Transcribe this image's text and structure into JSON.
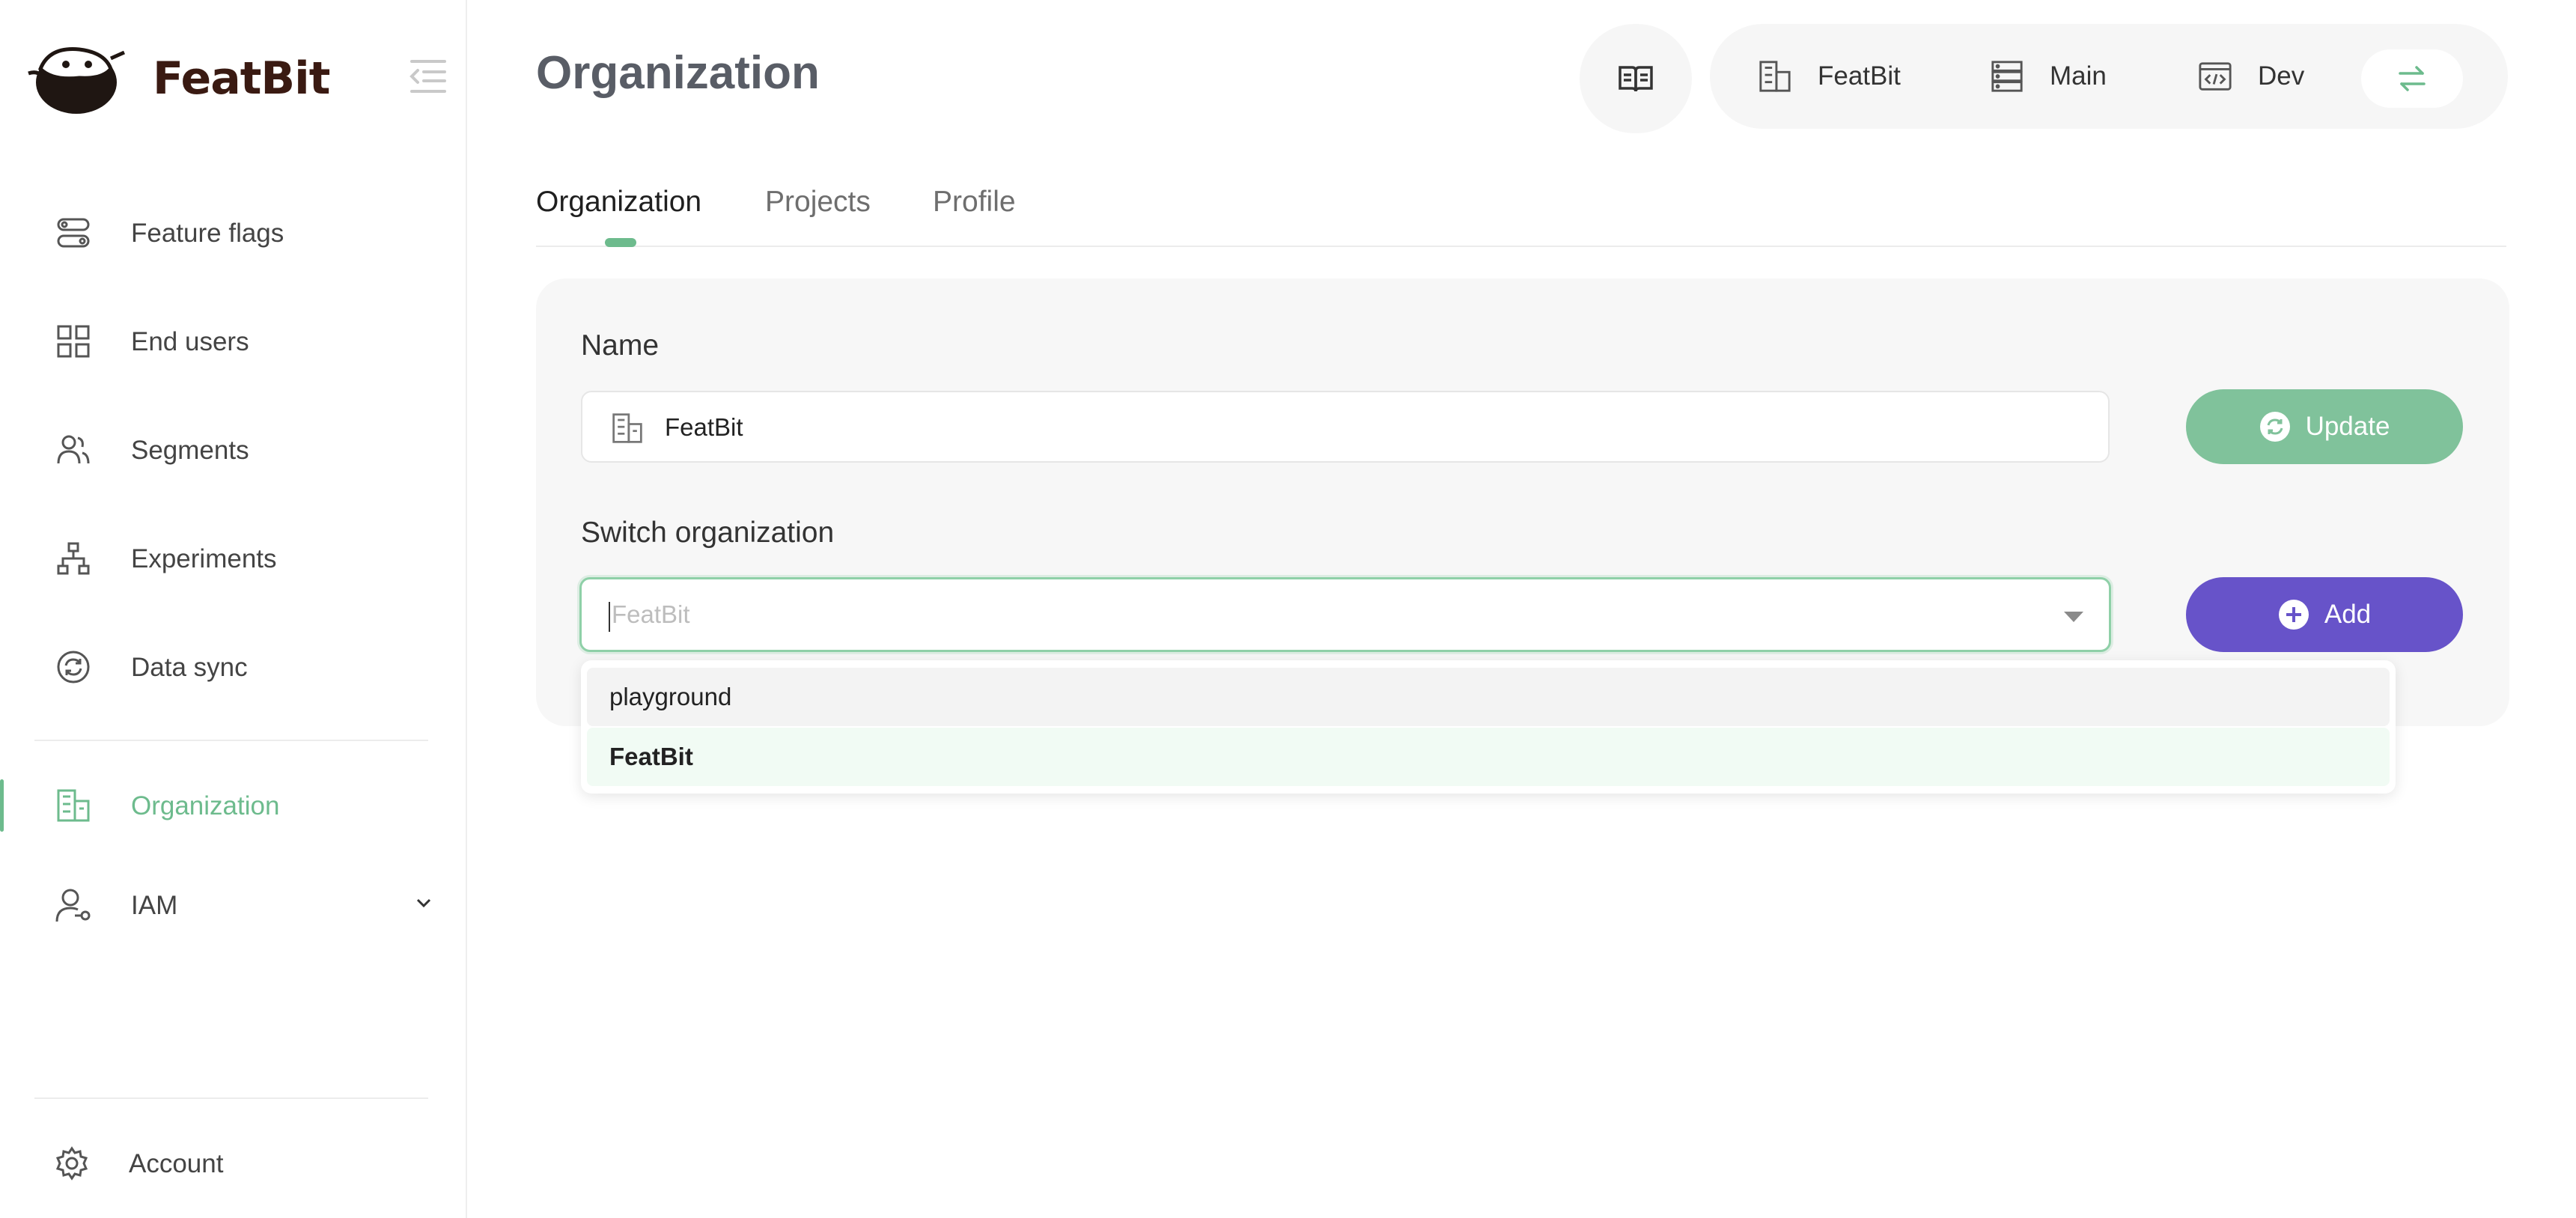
{
  "app": {
    "brand": "FeatBit"
  },
  "sidebar": {
    "items": [
      {
        "label": "Feature flags",
        "icon": "toggle-icon"
      },
      {
        "label": "End users",
        "icon": "grid-icon"
      },
      {
        "label": "Segments",
        "icon": "users-icon"
      },
      {
        "label": "Experiments",
        "icon": "hierarchy-icon"
      },
      {
        "label": "Data sync",
        "icon": "sync-icon"
      },
      {
        "label": "Organization",
        "icon": "building-icon",
        "active": true
      },
      {
        "label": "IAM",
        "icon": "user-key-icon"
      }
    ],
    "account": {
      "label": "Account",
      "icon": "gear-icon"
    }
  },
  "header": {
    "title": "Organization",
    "context": {
      "organization": "FeatBit",
      "project": "Main",
      "environment": "Dev"
    }
  },
  "tabs": [
    {
      "label": "Organization",
      "active": true
    },
    {
      "label": "Projects"
    },
    {
      "label": "Profile"
    }
  ],
  "form": {
    "name_label": "Name",
    "name_value": "FeatBit",
    "update_label": "Update",
    "switch_label": "Switch organization",
    "switch_placeholder": "FeatBit",
    "add_label": "Add",
    "options": [
      "playground",
      "FeatBit"
    ]
  },
  "colors": {
    "accent": "#6dbb8d",
    "primary": "#6753c9",
    "brand_text": "#3a1a12"
  }
}
